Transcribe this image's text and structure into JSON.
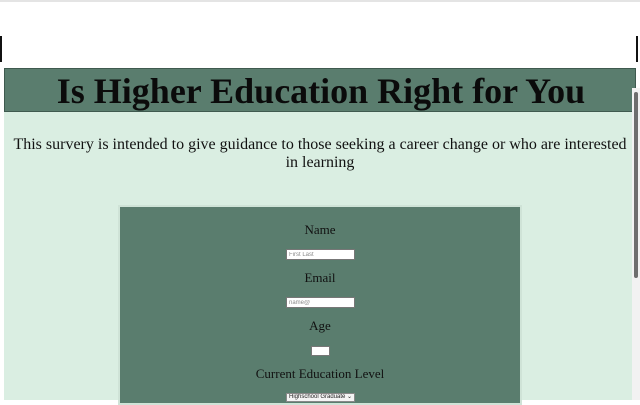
{
  "header": {
    "title": "Is Higher Education Right for You"
  },
  "intro": {
    "text": "This survery is intended to give guidance to those seeking a career change or who are interested in learning"
  },
  "form": {
    "name_label": "Name",
    "name_placeholder": "First Last",
    "email_label": "Email",
    "email_placeholder": "name@",
    "age_label": "Age",
    "education_label": "Current Education Level",
    "education_selected": "Highschool Graduate"
  },
  "icons": {
    "select_chevron": "chevron-down-icon"
  },
  "colors": {
    "page_background": "#daeee2",
    "header_background": "#5a7d6e",
    "form_background": "#5a7d6e"
  }
}
